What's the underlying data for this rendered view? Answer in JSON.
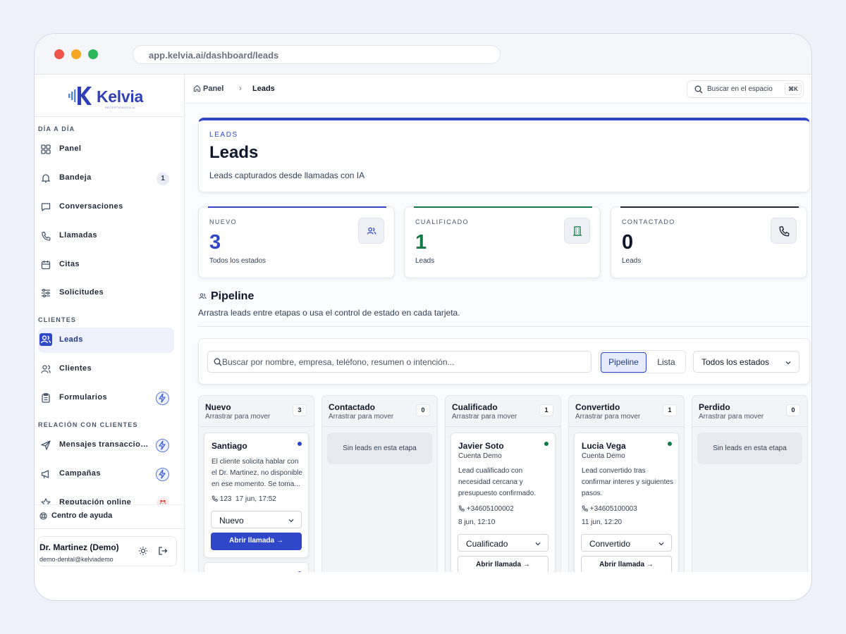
{
  "browser": {
    "url": "app.kelvia.ai/dashboard/leads"
  },
  "brand": {
    "name": "Kelvia",
    "tagline": "RECEPTIONISTA IA",
    "color": "#2f3fb6"
  },
  "sidebar": {
    "sections": [
      {
        "title": "DÍA A DÍA",
        "items": [
          {
            "label": "Panel",
            "icon": "grid-icon"
          },
          {
            "label": "Bandeja",
            "icon": "bell-icon",
            "badge": "1"
          },
          {
            "label": "Conversaciones",
            "icon": "chat-icon"
          },
          {
            "label": "Llamadas",
            "icon": "phone-icon"
          },
          {
            "label": "Citas",
            "icon": "calendar-icon"
          },
          {
            "label": "Solicitudes",
            "icon": "filter-icon"
          }
        ]
      },
      {
        "title": "CLIENTES",
        "items": [
          {
            "label": "Leads",
            "icon": "users-icon",
            "active": true
          },
          {
            "label": "Clientes",
            "icon": "user-icon"
          },
          {
            "label": "Formularios",
            "icon": "clipboard-icon",
            "bolt": true
          }
        ]
      },
      {
        "title": "RELACIÓN CON CLIENTES",
        "items": [
          {
            "label": "Mensajes transaccionales",
            "icon": "send-icon",
            "bolt": true
          },
          {
            "label": "Campañas",
            "icon": "megaphone-icon",
            "bolt": true
          },
          {
            "label": "Reputación online",
            "icon": "star-icon"
          }
        ]
      }
    ],
    "help": "Centro de ayuda",
    "user": {
      "name": "Dr. Martinez (Demo)",
      "email": "demo-dental@kelviademo"
    }
  },
  "topbar": {
    "breadcrumb": [
      "Panel",
      "Leads"
    ],
    "search_label": "Buscar en el espacio",
    "shortcut": "⌘K"
  },
  "hero": {
    "kicker": "LEADS",
    "title": "Leads",
    "description": "Leads capturados desde llamadas con IA"
  },
  "stats": [
    {
      "label": "NUEVO",
      "value": "3",
      "sub": "Todos los estados",
      "color": "#2f47c8",
      "icon": "users-icon"
    },
    {
      "label": "CUALIFICADO",
      "value": "1",
      "sub": "Leads",
      "color": "#0f7a45",
      "icon": "building-icon"
    },
    {
      "label": "CONTACTADO",
      "value": "0",
      "sub": "Leads",
      "color": "#0f172a",
      "icon": "phone-icon"
    }
  ],
  "pipeline": {
    "title": "Pipeline",
    "description": "Arrastra leads entre etapas o usa el control de estado en cada tarjeta.",
    "search_placeholder": "Buscar por nombre, empresa, teléfono, resumen o intención...",
    "view_options": [
      "Pipeline",
      "Lista"
    ],
    "active_view": "Pipeline",
    "status_filter": "Todos los estados",
    "drag_hint": "Arrastrar para mover",
    "empty_text": "Sin leads en esta etapa",
    "columns": [
      {
        "title": "Nuevo",
        "count": "3"
      },
      {
        "title": "Contactado",
        "count": "0"
      },
      {
        "title": "Cualificado",
        "count": "1"
      },
      {
        "title": "Convertido",
        "count": "1"
      },
      {
        "title": "Perdido",
        "count": "0"
      }
    ],
    "cards": {
      "santiago": {
        "name": "Santiago",
        "summary": "El cliente solicita hablar con el Dr. Martinez, no disponible en ese momento. Se toma...",
        "phone": "123",
        "date": "17 jun, 17:52",
        "status": "Nuevo",
        "action": "Abrir llamada"
      },
      "javier": {
        "name": "Javier Soto",
        "company": "Cuenta Demo",
        "summary": "Lead cualificado con necesidad cercana y presupuesto confirmado.",
        "phone": "+34605100002",
        "date": "8 jun, 12:10",
        "status": "Cualificado",
        "action": "Abrir llamada"
      },
      "lucia": {
        "name": "Lucia Vega",
        "company": "Cuenta Demo",
        "summary": "Lead convertido tras confirmar interes y siguientes pasos.",
        "phone": "+34605100003",
        "date": "11 jun, 12:20",
        "status": "Convertido",
        "action": "Abrir llamada"
      }
    }
  },
  "colors": {
    "accent": "#2f47c8",
    "success": "#0f7a45",
    "dot_new": "#2f47c8",
    "dot_ok": "#0f7a45"
  }
}
